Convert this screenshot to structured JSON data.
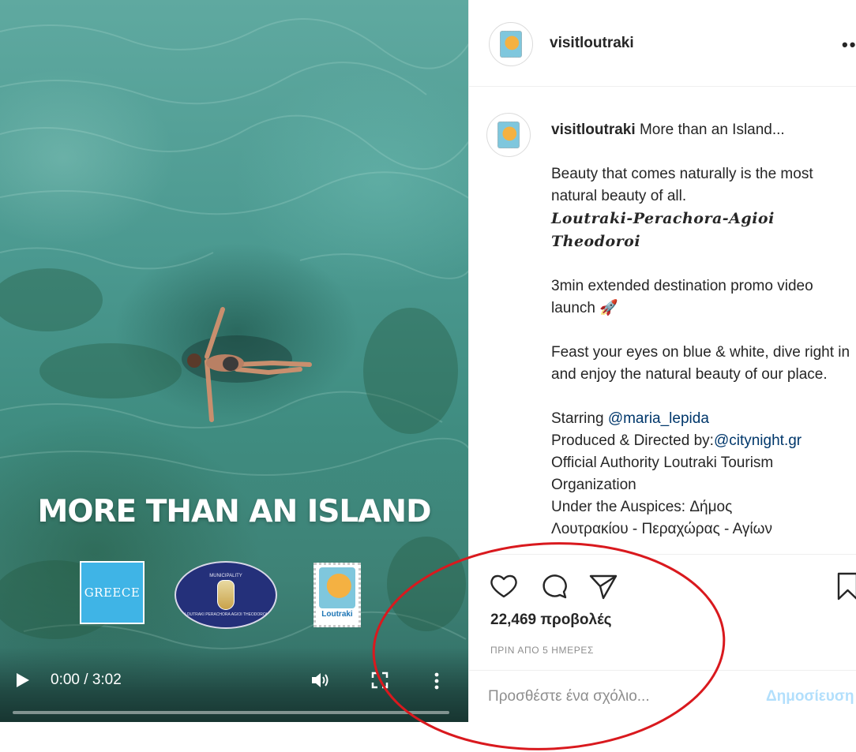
{
  "video": {
    "overlay_title": "MORE THAN AN ISLAND",
    "logos": {
      "greece": "GREECE",
      "municipality_top": "MUNICIPALITY",
      "municipality_bottom": "LOUTRAKI PERACHORA AGIOI THEODOROI",
      "stamp": "Loutraki"
    },
    "time": "0:00 / 3:02",
    "progress": 0,
    "icons": {
      "play": "play-icon",
      "volume": "volume-icon",
      "fullscreen": "fullscreen-icon",
      "more": "more-vertical-icon"
    }
  },
  "header": {
    "username": "visitloutraki",
    "options": "••"
  },
  "caption": {
    "username": "visitloutraki",
    "first_line": "More than an Island...",
    "para1": "Beauty that comes naturally is the most natural beauty of all.",
    "places": "Loutraki-Perachora-Agioi Theodoroi",
    "para2": "3min extended destination promo video launch 🚀",
    "para3": "Feast your eyes on blue & white, dive right in and enjoy the natural beauty of our place.",
    "starring_label": "Starring ",
    "starring_mention": "@maria_lepida",
    "produced_label": "Produced & Directed by:",
    "produced_mention": "@citynight.gr",
    "official": "Official Authority Loutraki Tourism Organization",
    "auspices": "Under the Auspices: Δήμος",
    "auspices_cont": "Λουτρακίου - Περαχώρας - Αγίων"
  },
  "actions": {
    "icons": [
      "heart-icon",
      "comment-icon",
      "share-icon",
      "bookmark-icon"
    ],
    "views": "22,469 προβολές",
    "posted": "ΠΡΙΝ ΑΠΟ 5 ΗΜΕΡΕΣ"
  },
  "comment": {
    "placeholder": "Προσθέστε ένα σχόλιο...",
    "post_label": "Δημοσίευση"
  },
  "colors": {
    "annotation": "#d9191e",
    "link": "#00376b",
    "post_disabled": "#b2dffc",
    "muted": "#8e8e8e"
  }
}
